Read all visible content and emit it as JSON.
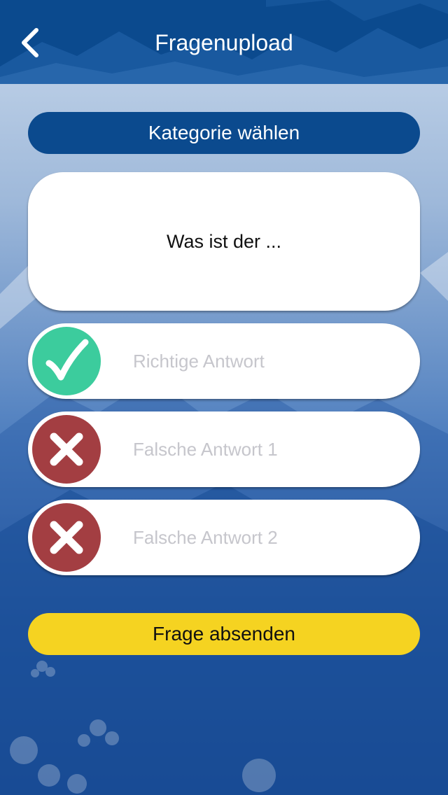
{
  "header": {
    "title": "Fragenupload",
    "back_icon": "chevron-left-icon"
  },
  "category": {
    "label": "Kategorie wählen"
  },
  "question": {
    "text": "Was ist der ..."
  },
  "answers": [
    {
      "placeholder": "Richtige Antwort",
      "value": "",
      "icon": "checkmark-icon",
      "status": "correct"
    },
    {
      "placeholder": "Falsche Antwort 1",
      "value": "",
      "icon": "cross-icon",
      "status": "wrong"
    },
    {
      "placeholder": "Falsche Antwort 2",
      "value": "",
      "icon": "cross-icon",
      "status": "wrong"
    }
  ],
  "submit": {
    "label": "Frage absenden"
  },
  "colors": {
    "header": "#0b4a8e",
    "primary_button": "#0b4a8e",
    "submit_button": "#f5d321",
    "correct": "#3ccc9d",
    "wrong": "#a33e42"
  }
}
